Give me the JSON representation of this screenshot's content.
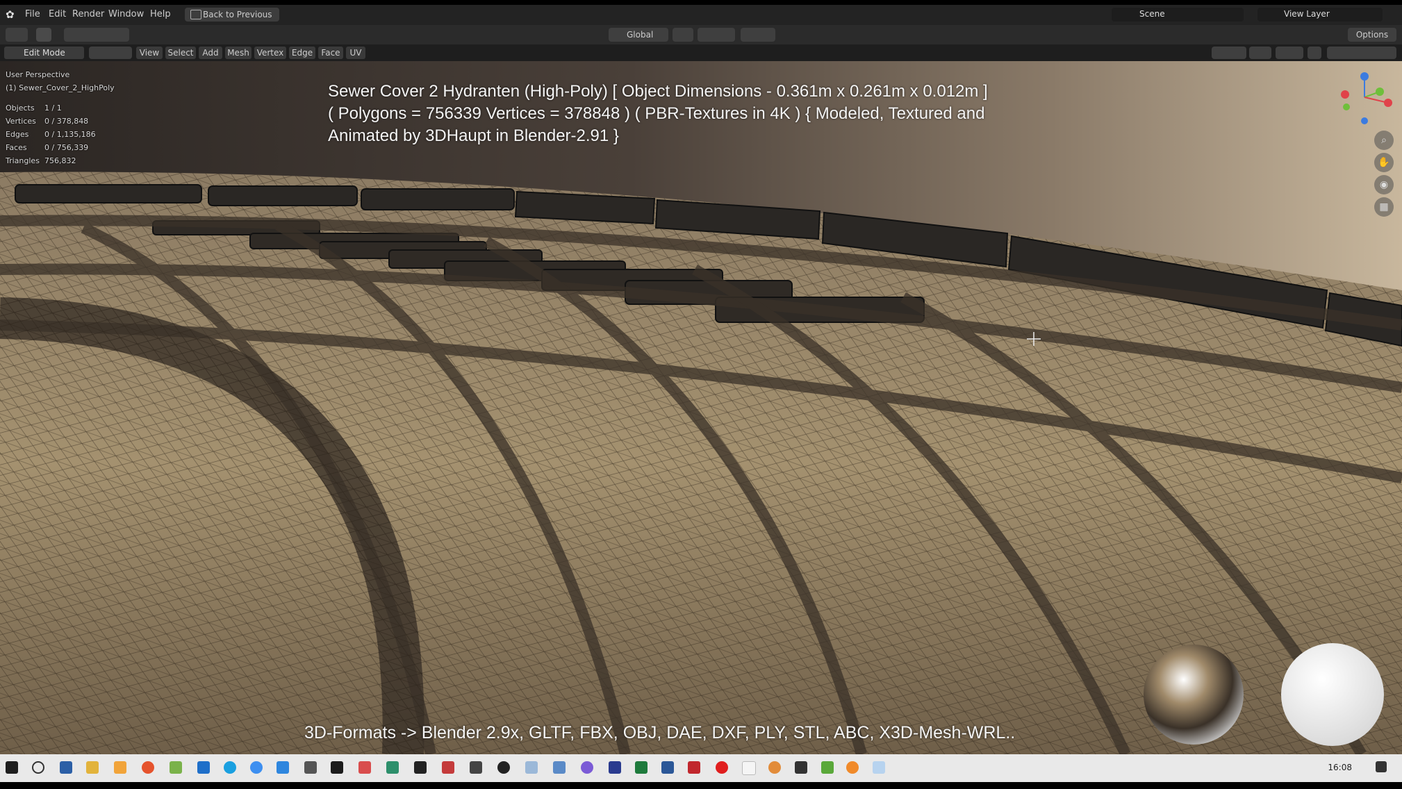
{
  "menubar": {
    "items": [
      "File",
      "Edit",
      "Render",
      "Window",
      "Help"
    ],
    "back_button": "Back to Previous",
    "scene": "Scene",
    "view_layer": "View Layer"
  },
  "toolbar": {
    "orientation": "Global",
    "options": "Options"
  },
  "header": {
    "mode": "Edit Mode",
    "menus": [
      "View",
      "Select",
      "Add",
      "Mesh",
      "Vertex",
      "Edge",
      "Face",
      "UV"
    ]
  },
  "viewport_info": {
    "perspective": "User Perspective",
    "object_name": "(1) Sewer_Cover_2_HighPoly",
    "stats": [
      {
        "label": "Objects",
        "value": "1 / 1"
      },
      {
        "label": "Vertices",
        "value": "0 / 378,848"
      },
      {
        "label": "Edges",
        "value": "0 / 1,135,186"
      },
      {
        "label": "Faces",
        "value": "0 / 756,339"
      },
      {
        "label": "Triangles",
        "value": "756,832"
      }
    ]
  },
  "overlay": {
    "line1": "Sewer Cover 2 Hydranten (High-Poly) [ Object Dimensions -  0.361m x 0.261m x 0.012m ]",
    "line2": "( Polygons = 756339 Vertices = 378848 ) ( PBR-Textures in 4K ) { Modeled, Textured and",
    "line3": "Animated by 3DHaupt in Blender-2.91 }",
    "formats": "3D-Formats -> Blender 2.9x, GLTF, FBX, OBJ, DAE, DXF, PLY, STL, ABC, X3D-Mesh-WRL.."
  },
  "taskbar": {
    "time": "16:08"
  },
  "colors": {
    "menubar_bg": "#232323",
    "toolbar_bg": "#2b2b2b",
    "taskbar_bg": "#e9e9e9",
    "accent_blue": "#4772b3"
  },
  "icons": [
    "blender-logo-icon",
    "search-icon",
    "zoom-icon",
    "hand-icon",
    "camera-icon",
    "grid-icon",
    "windows-start-icon"
  ]
}
